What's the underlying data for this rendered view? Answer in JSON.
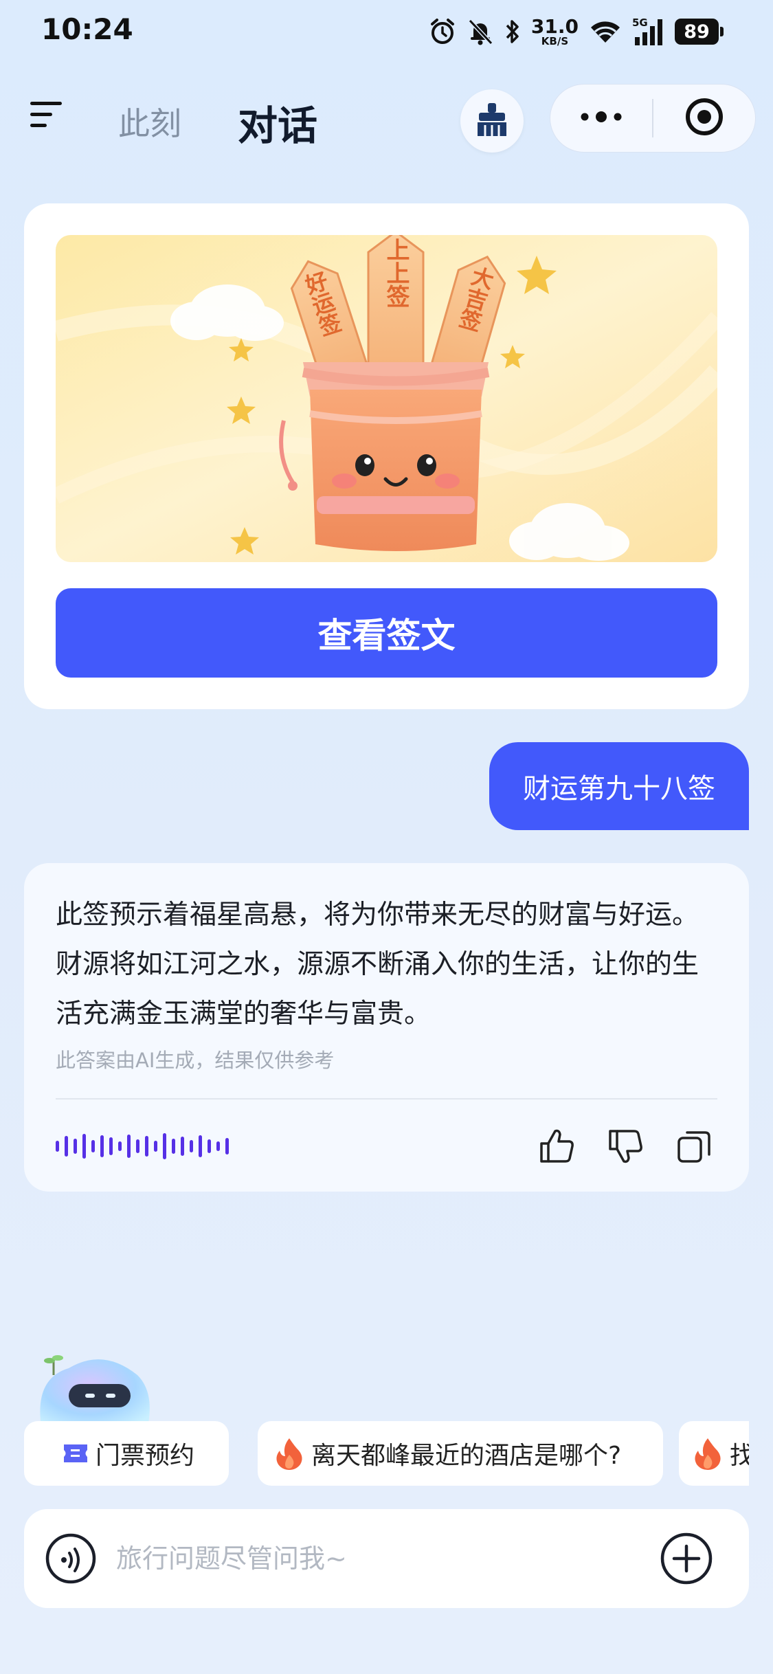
{
  "status_bar": {
    "time": "10:24",
    "net_speed_value": "31.0",
    "net_speed_unit": "KB/S",
    "network_type": "5G",
    "battery": "89"
  },
  "header": {
    "tab_moment": "此刻",
    "tab_chat": "对话",
    "active_tab": "对话"
  },
  "fortune_card": {
    "stick_labels": [
      "好运签",
      "上上签",
      "大吉签"
    ],
    "view_button": "查看签文"
  },
  "user_message": "财运第九十八签",
  "ai_reply": {
    "text": "此签预示着福星高悬，将为你带来无尽的财富与好运。财源将如江河之水，源源不断涌入你的生活，让你的生活充满金玉满堂的奢华与富贵。",
    "disclaimer": "此答案由AI生成，结果仅供参考"
  },
  "suggestions": [
    {
      "icon": "ticket-icon",
      "label": "门票预约"
    },
    {
      "icon": "fire-icon",
      "label": "离天都峰最近的酒店是哪个?"
    },
    {
      "icon": "fire-icon",
      "label": "找"
    }
  ],
  "input": {
    "placeholder": "旅行问题尽管问我~",
    "value": ""
  },
  "colors": {
    "accent": "#4259fb",
    "background": "#dcebfd",
    "card": "#ffffff"
  }
}
